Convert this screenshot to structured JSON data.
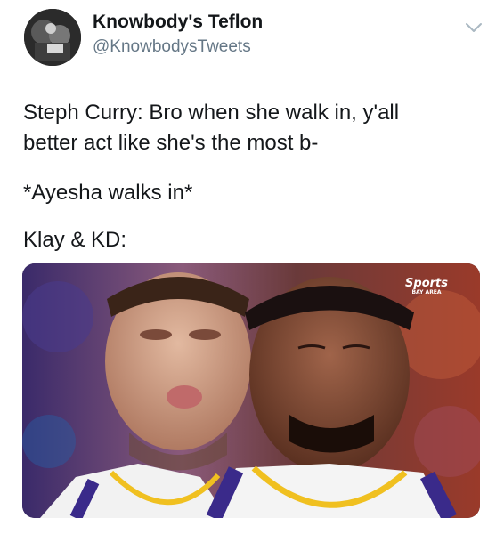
{
  "author": {
    "display_name": "Knowbody's Teflon",
    "handle": "@KnowbodysTweets",
    "avatar_icon": "profile-photo"
  },
  "menu": {
    "icon": "chevron-down-icon"
  },
  "tweet_text": {
    "line1": "Steph Curry: Bro when she walk in, y'all",
    "line2": "better act like she's the most b-",
    "line3": "*Ayesha walks in*",
    "line4": "Klay & KD:"
  },
  "media": {
    "watermark_brand": "Sports",
    "watermark_sub": "BAY AREA"
  },
  "colors": {
    "text": "#14171a",
    "secondary": "#657786",
    "caret": "#aab8c2"
  }
}
